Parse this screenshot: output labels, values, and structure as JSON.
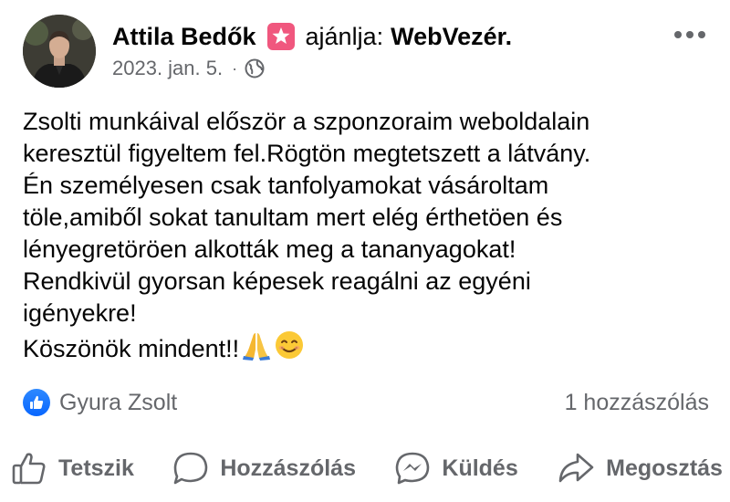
{
  "post": {
    "author": "Attila Bedők",
    "recommend_verb": "ajánlja:",
    "page_name": "WebVezér.",
    "date": "2023. jan. 5.",
    "meta_separator": "·",
    "privacy_icon": "globe-icon",
    "more_icon": "more-dots-icon",
    "recommend_icon": "star-badge-icon",
    "body_lines": [
      "Zsolti munkáival először a szponzoraim weboldalain",
      "keresztül figyeltem fel.Rögtön megtetszett a látvány.",
      "Én személyesen csak tanfolyamokat vásároltam",
      "töle,amiből sokat tanultam mert elég érthetöen és",
      "lényegretöröen alkották meg a tananyagokat!",
      "Rendkivül gyorsan képesek reagálni az egyéni",
      "igényekre!",
      "Köszönök mindent!!"
    ],
    "closing_emojis": [
      "folded-hands-emoji",
      "smiling-face-emoji"
    ]
  },
  "reactions": {
    "reactor": "Gyura Zsolt",
    "comment_count": "1 hozzászólás",
    "reaction_icon": "like-reaction-icon"
  },
  "actions": {
    "like": "Tetszik",
    "comment": "Hozzászólás",
    "send": "Küldés",
    "share": "Megosztás"
  },
  "colors": {
    "text": "#050505",
    "secondary_text": "#65676b",
    "like_blue": "#0866ff",
    "recommend_pink": "#f0577e"
  }
}
